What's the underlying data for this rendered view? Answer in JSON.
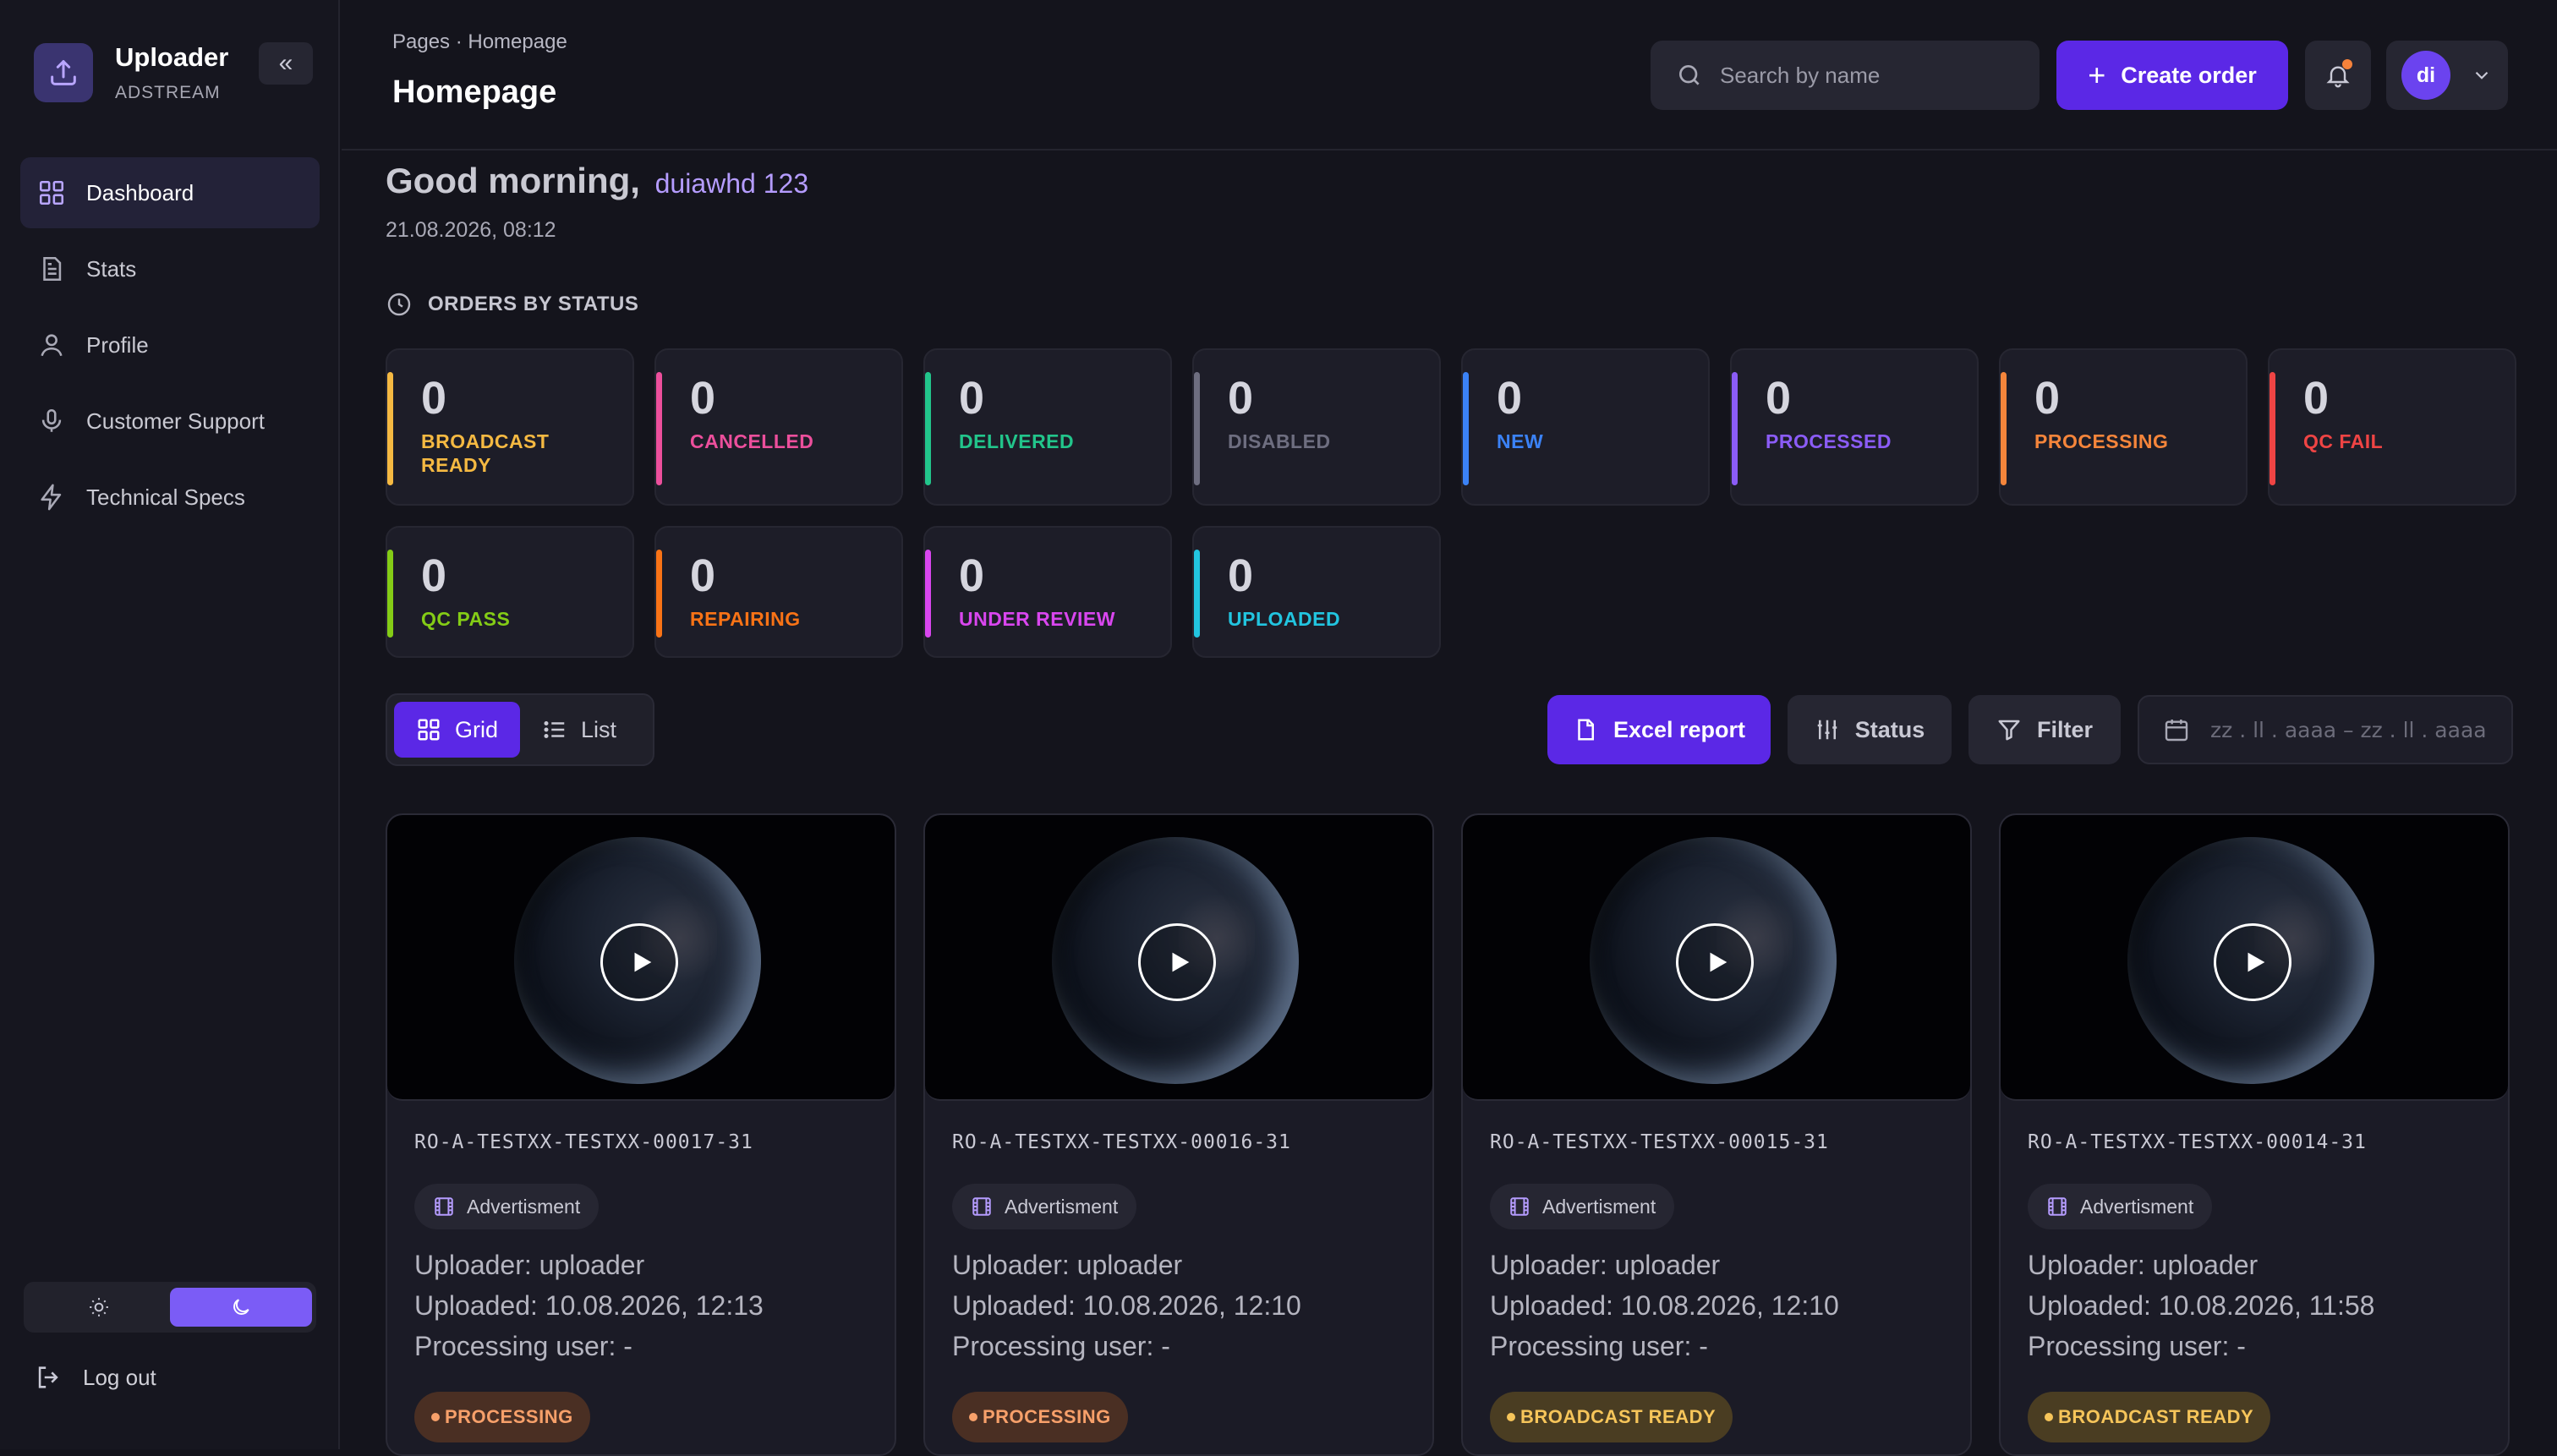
{
  "app": {
    "name": "Uploader",
    "subtitle": "ADSTREAM",
    "collapse_icon": "double-chevron-left-icon"
  },
  "sidebar": {
    "items": [
      {
        "label": "Dashboard",
        "icon": "grid-icon",
        "active": true
      },
      {
        "label": "Stats",
        "icon": "document-icon"
      },
      {
        "label": "Profile",
        "icon": "user-icon"
      },
      {
        "label": "Customer Support",
        "icon": "microphone-icon"
      },
      {
        "label": "Technical Specs",
        "icon": "lightning-icon"
      }
    ],
    "theme": {
      "options": [
        "sun-icon",
        "moon-icon"
      ],
      "selected": "dark"
    },
    "logout_label": "Log out"
  },
  "header": {
    "breadcrumb": "Pages · Homepage",
    "title": "Homepage",
    "search_placeholder": "Search by name",
    "create_label": "Create order",
    "user_initials": "di"
  },
  "greeting": {
    "text": "Good morning,",
    "name": "duiawhd 123",
    "datetime": "21.08.2026, 08:12"
  },
  "orders_section": {
    "title": "ORDERS BY STATUS"
  },
  "statuses": [
    {
      "count": "0",
      "label": "BROADCAST\nREADY",
      "color": "#f5b942"
    },
    {
      "count": "0",
      "label": "CANCELLED",
      "color": "#ec4f9c"
    },
    {
      "count": "0",
      "label": "DELIVERED",
      "color": "#22c58b"
    },
    {
      "count": "0",
      "label": "DISABLED",
      "color": "#6e6e80"
    },
    {
      "count": "0",
      "label": "NEW",
      "color": "#3b82f6"
    },
    {
      "count": "0",
      "label": "PROCESSED",
      "color": "#8b5cf6"
    },
    {
      "count": "0",
      "label": "PROCESSING",
      "color": "#f5853b"
    },
    {
      "count": "0",
      "label": "QC FAIL",
      "color": "#ef4444"
    },
    {
      "count": "0",
      "label": "QC PASS",
      "color": "#84cc16"
    },
    {
      "count": "0",
      "label": "REPAIRING",
      "color": "#f97316"
    },
    {
      "count": "0",
      "label": "UNDER REVIEW",
      "color": "#d946ef"
    },
    {
      "count": "0",
      "label": "UPLOADED",
      "color": "#22c5e0"
    }
  ],
  "toolbar": {
    "grid_label": "Grid",
    "list_label": "List",
    "view_selected": "Grid",
    "excel_label": "Excel report",
    "status_label": "Status",
    "filter_label": "Filter",
    "date_placeholder": "zz . ll . aaaa  –  zz . ll . aaaa"
  },
  "orders": [
    {
      "code": "RO-A-TESTXX-TESTXX-00017-31",
      "type": "Advertisment",
      "uploader": "Uploader: uploader",
      "uploaded": "Uploaded: 10.08.2026, 12:13",
      "processing_user": "Processing user: -",
      "status": "PROCESSING"
    },
    {
      "code": "RO-A-TESTXX-TESTXX-00016-31",
      "type": "Advertisment",
      "uploader": "Uploader: uploader",
      "uploaded": "Uploaded: 10.08.2026, 12:10",
      "processing_user": "Processing user: -",
      "status": "PROCESSING"
    },
    {
      "code": "RO-A-TESTXX-TESTXX-00015-31",
      "type": "Advertisment",
      "uploader": "Uploader: uploader",
      "uploaded": "Uploaded: 10.08.2026, 12:10",
      "processing_user": "Processing user: -",
      "status": "BROADCAST READY"
    },
    {
      "code": "RO-A-TESTXX-TESTXX-00014-31",
      "type": "Advertisment",
      "uploader": "Uploader: uploader",
      "uploaded": "Uploaded: 10.08.2026, 11:58",
      "processing_user": "Processing user: -",
      "status": "BROADCAST READY"
    }
  ],
  "badge_styles": {
    "PROCESSING": {
      "bg": "#4a2f23",
      "fg": "#f7a06a"
    },
    "BROADCAST READY": {
      "bg": "#4a3d22",
      "fg": "#f6c55a"
    }
  }
}
